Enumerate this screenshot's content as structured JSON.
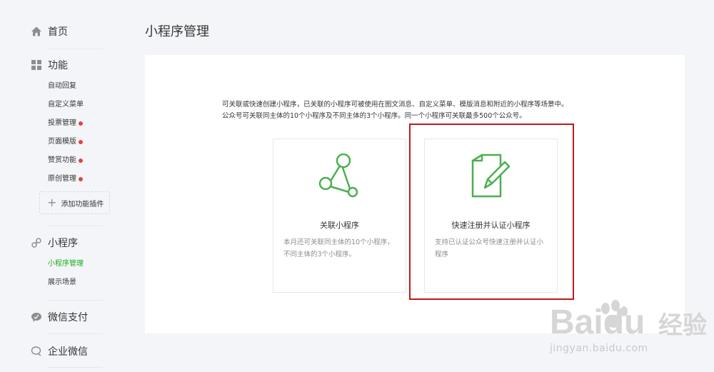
{
  "sidebar": {
    "home": "首页",
    "features": {
      "title": "功能",
      "items": [
        {
          "label": "自动回复",
          "dot": false
        },
        {
          "label": "自定义菜单",
          "dot": false
        },
        {
          "label": "投票管理",
          "dot": true
        },
        {
          "label": "页面模版",
          "dot": true
        },
        {
          "label": "赞赏功能",
          "dot": true
        },
        {
          "label": "原创管理",
          "dot": true
        }
      ],
      "add_plugin": "添加功能插件"
    },
    "miniprogram": {
      "title": "小程序",
      "items": [
        {
          "label": "小程序管理",
          "active": true
        },
        {
          "label": "展示场景",
          "active": false
        }
      ]
    },
    "wechat_pay": "微信支付",
    "enterprise_wechat": "企业微信"
  },
  "main": {
    "title": "小程序管理",
    "description": [
      "可关联或快速创建小程序，已关联的小程序可被使用在图文消息、自定义菜单、模版消息和附近的小程序等场景中。",
      "公众号可关联同主体的10个小程序及不同主体的3个小程序。同一个小程序可关联最多500个公众号。"
    ],
    "cards": [
      {
        "title": "关联小程序",
        "desc": "本月还可关联同主体的10个小程序，不同主体的3个小程序。",
        "icon": "share-nodes-icon"
      },
      {
        "title": "快速注册并认证小程序",
        "desc": "支持已认证公众号快速注册并认证小程序",
        "icon": "document-pen-icon"
      }
    ]
  },
  "watermark": {
    "brand": "Baidu",
    "brand_cn": "经验",
    "url": "jingyan.baidu.com"
  },
  "colors": {
    "accent": "#1aad19",
    "highlight": "#c11919",
    "badge": "#e64340"
  }
}
